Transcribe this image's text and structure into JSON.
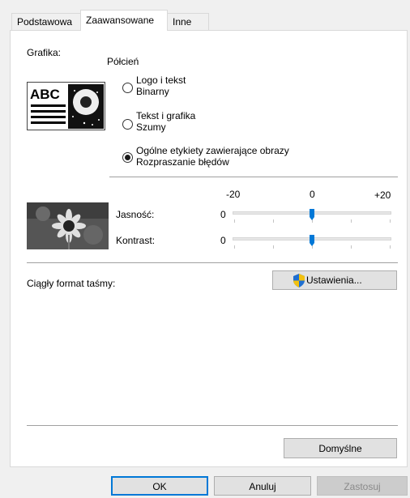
{
  "tabs": [
    {
      "label": "Podstawowa"
    },
    {
      "label": "Zaawansowane"
    },
    {
      "label": "Inne"
    }
  ],
  "graphics": {
    "label": "Grafika:",
    "halftone_label": "Półcień",
    "preview_text": "ABC",
    "options": [
      {
        "line1": "Logo i tekst",
        "line2": "Binarny",
        "selected": false
      },
      {
        "line1": "Tekst i grafika",
        "line2": "Szumy",
        "selected": false
      },
      {
        "line1": "Ogólne etykiety zawierające obrazy",
        "line2": "Rozpraszanie błędów",
        "selected": true
      }
    ]
  },
  "sliders": {
    "scale_min": "-20",
    "scale_mid": "0",
    "scale_max": "+20",
    "brightness": {
      "label": "Jasność:",
      "value": "0",
      "level": 0
    },
    "contrast": {
      "label": "Kontrast:",
      "value": "0",
      "level": 0
    }
  },
  "tape_format": {
    "label": "Ciągły format taśmy:",
    "settings_button": "Ustawienia..."
  },
  "defaults_button": "Domyślne",
  "footer": {
    "ok": "OK",
    "cancel": "Anuluj",
    "apply": "Zastosuj"
  },
  "colors": {
    "accent": "#0078d7",
    "shield_blue": "#1f6fd1",
    "shield_yellow": "#f2c10f"
  },
  "icons": [
    "shield-icon"
  ]
}
